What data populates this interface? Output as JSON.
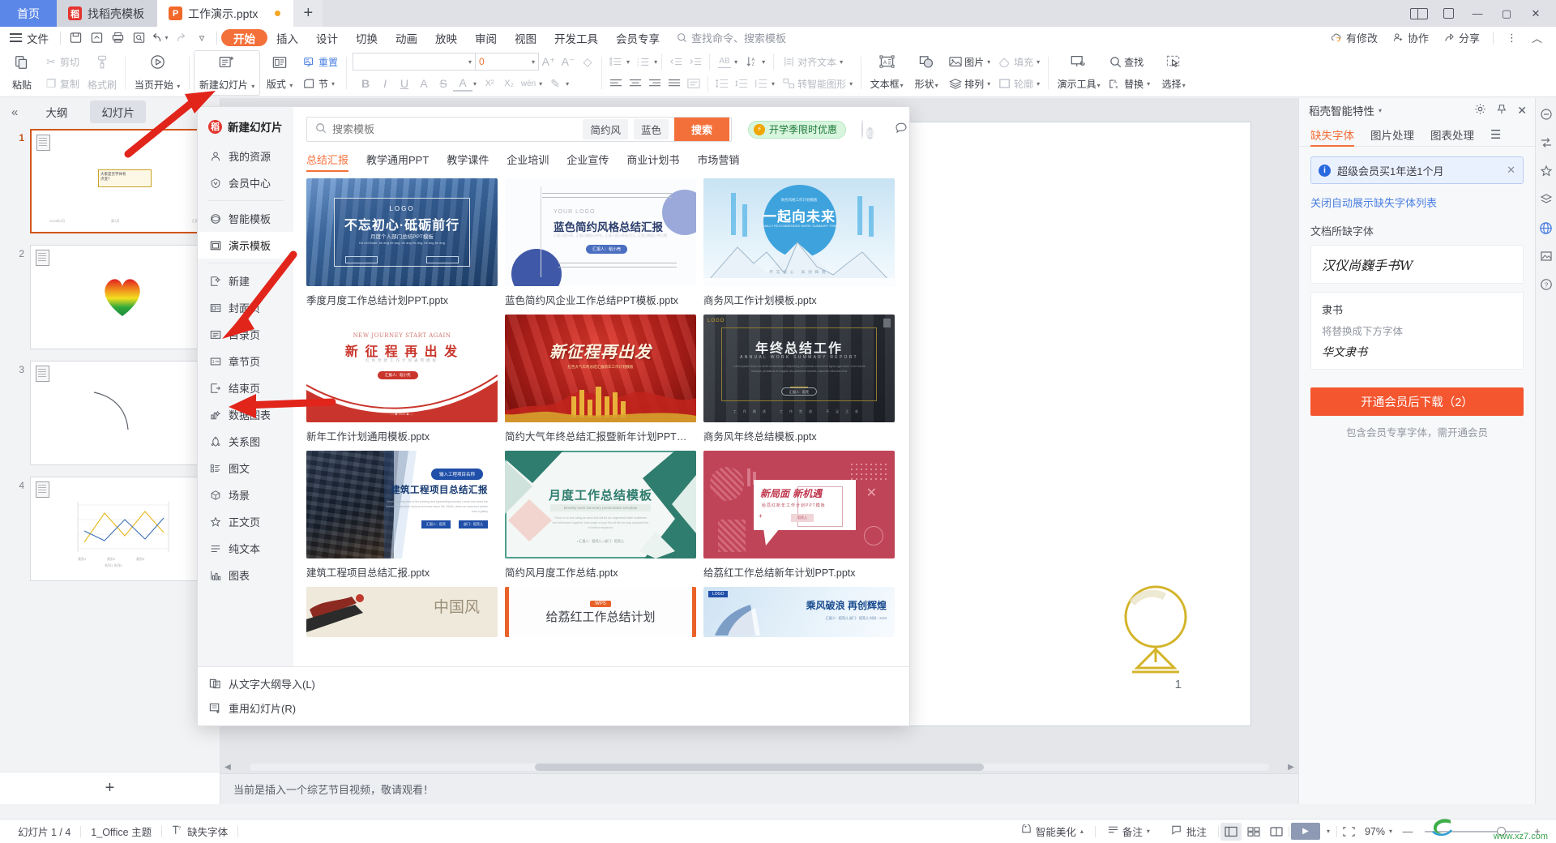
{
  "window": {
    "tabs": [
      {
        "label": "首页",
        "type": "home"
      },
      {
        "label": "找稻壳模板",
        "type": "doc",
        "icon": "daoke-icon"
      },
      {
        "label": "工作演示.pptx",
        "type": "doc",
        "icon": "ppt-icon",
        "active": true,
        "modified": true
      }
    ],
    "new_tab": "+",
    "controls": {
      "split": "split-view",
      "restore": "▭",
      "minimize": "—",
      "maximize": "▢",
      "close": "✕"
    }
  },
  "menubar": {
    "file": "文件",
    "quick": [
      "save-icon",
      "save-as-icon",
      "print-icon",
      "print-preview-icon",
      "undo-icon",
      "redo-icon",
      "more-icon"
    ],
    "tabs": [
      "开始",
      "插入",
      "设计",
      "切换",
      "动画",
      "放映",
      "审阅",
      "视图",
      "开发工具",
      "会员专享"
    ],
    "active_tab": "开始",
    "search_placeholder": "查找命令、搜索模板",
    "right": [
      {
        "label": "有修改",
        "icon": "cloud-sync-icon"
      },
      {
        "label": "协作",
        "icon": "collaborate-icon"
      },
      {
        "label": "分享",
        "icon": "share-icon"
      }
    ],
    "more": "⋮",
    "collapse": "︿"
  },
  "ribbon": {
    "paste": {
      "label": "粘贴",
      "icon": "paste-icon"
    },
    "cut": {
      "label": "剪切",
      "icon": "scissors-icon"
    },
    "copy": {
      "label": "复制",
      "icon": "copy-icon"
    },
    "format_painter": {
      "label": "格式刷",
      "icon": "brush-icon"
    },
    "start_from_page": {
      "label": "当页开始",
      "icon": "play-circle-icon"
    },
    "new_slide": {
      "label": "新建幻灯片",
      "icon": "new-slide-icon"
    },
    "layout": {
      "label": "版式",
      "icon": "layout-icon"
    },
    "reset": {
      "label": "重置",
      "icon": "reset-icon"
    },
    "section": {
      "label": "节",
      "icon": "section-icon"
    },
    "font_name": "",
    "font_name_placeholder": "",
    "font_size": "0",
    "grow_font": "A⁺",
    "shrink_font": "A⁻",
    "clear_format": "◇",
    "bold": "B",
    "italic": "I",
    "underline": "U",
    "shadow": "A",
    "strike": "S",
    "font_color": "A",
    "superscript": "X²",
    "subscript": "X₂",
    "phonetic": "wén",
    "highlight": "✎",
    "bullets": "bullet-list-icon",
    "numbering": "numbered-list-icon",
    "dec_indent": "decrease-indent-icon",
    "inc_indent": "increase-indent-icon",
    "align_left": "align-left-icon",
    "align_center": "align-center-icon",
    "align_right": "align-right-icon",
    "justify": "justify-icon",
    "distribute": "distribute-icon",
    "text_direction": {
      "label": "AB",
      "icon": "text-direction-icon"
    },
    "sort": {
      "label": "",
      "icon": "sort-icon"
    },
    "line_spacing": "line-spacing-icon",
    "para_spacing": "para-spacing-icon",
    "row-spacing": "row-spacing-icon",
    "align_text": {
      "label": "对齐文本",
      "icon": "align-text-icon"
    },
    "smart_art": {
      "label": "转智能图形",
      "icon": "smartart-icon"
    },
    "textbox": {
      "label": "文本框",
      "icon": "textbox-icon"
    },
    "shape": {
      "label": "形状",
      "icon": "shape-icon"
    },
    "picture": {
      "label": "图片",
      "icon": "picture-icon"
    },
    "arrange": {
      "label": "排列",
      "icon": "arrange-icon"
    },
    "fill": {
      "label": "填充",
      "icon": "fill-icon"
    },
    "outline": {
      "label": "轮廓",
      "icon": "outline-icon"
    },
    "present_tools": {
      "label": "演示工具",
      "icon": "present-tools-icon"
    },
    "find": {
      "label": "查找",
      "icon": "search-icon"
    },
    "replace": {
      "label": "替换",
      "icon": "replace-icon"
    },
    "select": {
      "label": "选择",
      "icon": "select-icon"
    }
  },
  "slide_panel": {
    "collapse": "«",
    "tabs": [
      "大纲",
      "幻灯片"
    ],
    "active_tab": "幻灯片",
    "slides": [
      {
        "number": "1",
        "selected": true,
        "kind": "title"
      },
      {
        "number": "2",
        "selected": false,
        "kind": "heart"
      },
      {
        "number": "3",
        "selected": false,
        "kind": "curve"
      },
      {
        "number": "4",
        "selected": false,
        "kind": "chart"
      }
    ],
    "add_slide": "+"
  },
  "editor": {
    "slide_number": "1",
    "notes_text": "当前是插入一个综艺节目视频，敬请观看！"
  },
  "right_panel": {
    "title": "稻壳智能特性",
    "header_icons": [
      "gear-icon",
      "pin-icon",
      "close-icon"
    ],
    "tabs": [
      "缺失字体",
      "图片处理",
      "图表处理"
    ],
    "active_tab": "缺失字体",
    "more_icon": "menu-icon",
    "notice": {
      "text": "超级会员买1年送1个月",
      "close": "✕"
    },
    "link": "关闭自动展示缺失字体列表",
    "section_label": "文档所缺字体",
    "missing_font": "汉仪尚巍手书W",
    "replace_from": "隶书",
    "replace_hint": "将替换成下方字体",
    "replace_to": "华文隶书",
    "download_button": "开通会员后下载（2）",
    "download_note": "包含会员专享字体，需开通会员"
  },
  "rail": {
    "icons": [
      "shape-rail-icon",
      "transform-rail-icon",
      "star-rail-icon",
      "layers-rail-icon",
      "globe-rail-icon",
      "image-rail-icon",
      "help-rail-icon"
    ]
  },
  "statusbar": {
    "slide_count": "幻灯片 1 / 4",
    "theme": "1_Office 主题",
    "missing_font": "缺失字体",
    "missing_font_icon": "missing-font-icon",
    "beautify": "智能美化",
    "notes": "备注",
    "comments": "批注",
    "views": [
      "normal-view-icon",
      "slide-sorter-icon",
      "reading-view-icon"
    ],
    "active_view": "normal-view-icon",
    "play": "▶",
    "fit": "fit-icon",
    "zoom": "97%",
    "zoom_out": "—",
    "zoom_in": "+",
    "watermark": "www.xz7.com"
  },
  "dropdown": {
    "title": "新建幻灯片",
    "menu": [
      {
        "label": "我的资源",
        "icon": "person-icon"
      },
      {
        "label": "会员中心",
        "icon": "vip-icon"
      },
      {
        "divider": true
      },
      {
        "label": "智能模板",
        "icon": "smart-template-icon"
      },
      {
        "label": "演示模板",
        "icon": "presentation-template-icon",
        "active": true
      },
      {
        "divider": true
      },
      {
        "label": "新建",
        "icon": "new-icon"
      },
      {
        "label": "封面页",
        "icon": "cover-icon"
      },
      {
        "label": "目录页",
        "icon": "toc-icon"
      },
      {
        "label": "章节页",
        "icon": "chapter-icon"
      },
      {
        "label": "结束页",
        "icon": "end-icon"
      },
      {
        "label": "数据图表",
        "icon": "data-chart-icon"
      },
      {
        "label": "关系图",
        "icon": "relation-icon"
      },
      {
        "label": "图文",
        "icon": "image-text-icon"
      },
      {
        "label": "场景",
        "icon": "scene-icon"
      },
      {
        "label": "正文页",
        "icon": "body-icon"
      },
      {
        "label": "纯文本",
        "icon": "plain-text-icon"
      },
      {
        "label": "图表",
        "icon": "chart-icon"
      }
    ],
    "footer": [
      {
        "label": "从文字大纲导入(L)",
        "icon": "import-outline-icon"
      },
      {
        "label": "重用幻灯片(R)",
        "icon": "reuse-slide-icon"
      }
    ],
    "search": {
      "placeholder": "搜索模板",
      "icon": "search-icon"
    },
    "chips": [
      "简约风",
      "蓝色"
    ],
    "search_button": "搜索",
    "promo": "开学季限时优惠",
    "feedback_icon": "feedback-icon",
    "categories": [
      "总结汇报",
      "教学通用PPT",
      "教学课件",
      "企业培训",
      "企业宣传",
      "商业计划书",
      "市场营销"
    ],
    "active_category": "总结汇报",
    "templates": [
      {
        "name": "季度月度工作总结计划PPT.pptx",
        "style": "city-blue",
        "title": "不忘初心·砥砺前行",
        "logo": "LOGO",
        "sub": "月度个人部门总结PPT模板"
      },
      {
        "name": "蓝色简约风企业工作总结PPT模板.pptx",
        "style": "blue-minimal",
        "title": "蓝色简约风格总结汇报",
        "logo": "YOUR LOGO",
        "sub": "汇报人：稻小壳"
      },
      {
        "name": "商务风工作计划模板.pptx",
        "style": "mountain-blue",
        "title": "一起向未来",
        "logo": "",
        "sub": "商务风格工作计划模板"
      },
      {
        "name": "新年工作计划通用模板.pptx",
        "style": "red-white",
        "title": "新 征 程  再 出 发",
        "logo": "NEW JOURNEY START AGAIN",
        "sub": "红色党政工作计划通用模板"
      },
      {
        "name": "简约大气年终总结汇报暨新年计划PPT模板...",
        "style": "red-gold",
        "title": "新征程再出发",
        "logo": "",
        "sub": "红色大气年终总结汇报新年工作计划模板"
      },
      {
        "name": "商务风年终总结模板.pptx",
        "style": "dark-business",
        "title": "年终总结工作",
        "logo": "LOGO",
        "sub": "ANNUAL WORK SUMMARY REPORT"
      },
      {
        "name": "建筑工程项目总结汇报.pptx",
        "style": "construction",
        "title": "建筑工程项目总结汇报",
        "logo": "输入工程项目名称",
        "sub": ""
      },
      {
        "name": "简约风月度工作总结.pptx",
        "style": "green-geo",
        "title": "月度工作总结模板",
        "logo": "",
        "sub": "Monthly work summary presentation template"
      },
      {
        "name": "给荔红工作总结新年计划PPT.pptx",
        "style": "pink-red",
        "title": "新局面 新机遇",
        "logo": "",
        "sub": "给荔红新年工作计划PPT模板"
      },
      {
        "name": "",
        "style": "ink-wash",
        "title": "中国风",
        "logo": "",
        "sub": ""
      },
      {
        "name": "",
        "style": "wps-plan",
        "title": "给荔红工作总结计划",
        "logo": "WPS",
        "sub": ""
      },
      {
        "name": "",
        "style": "sail-blue",
        "title": "乘风破浪 再创辉煌",
        "logo": "LOGO",
        "sub": ""
      }
    ]
  }
}
